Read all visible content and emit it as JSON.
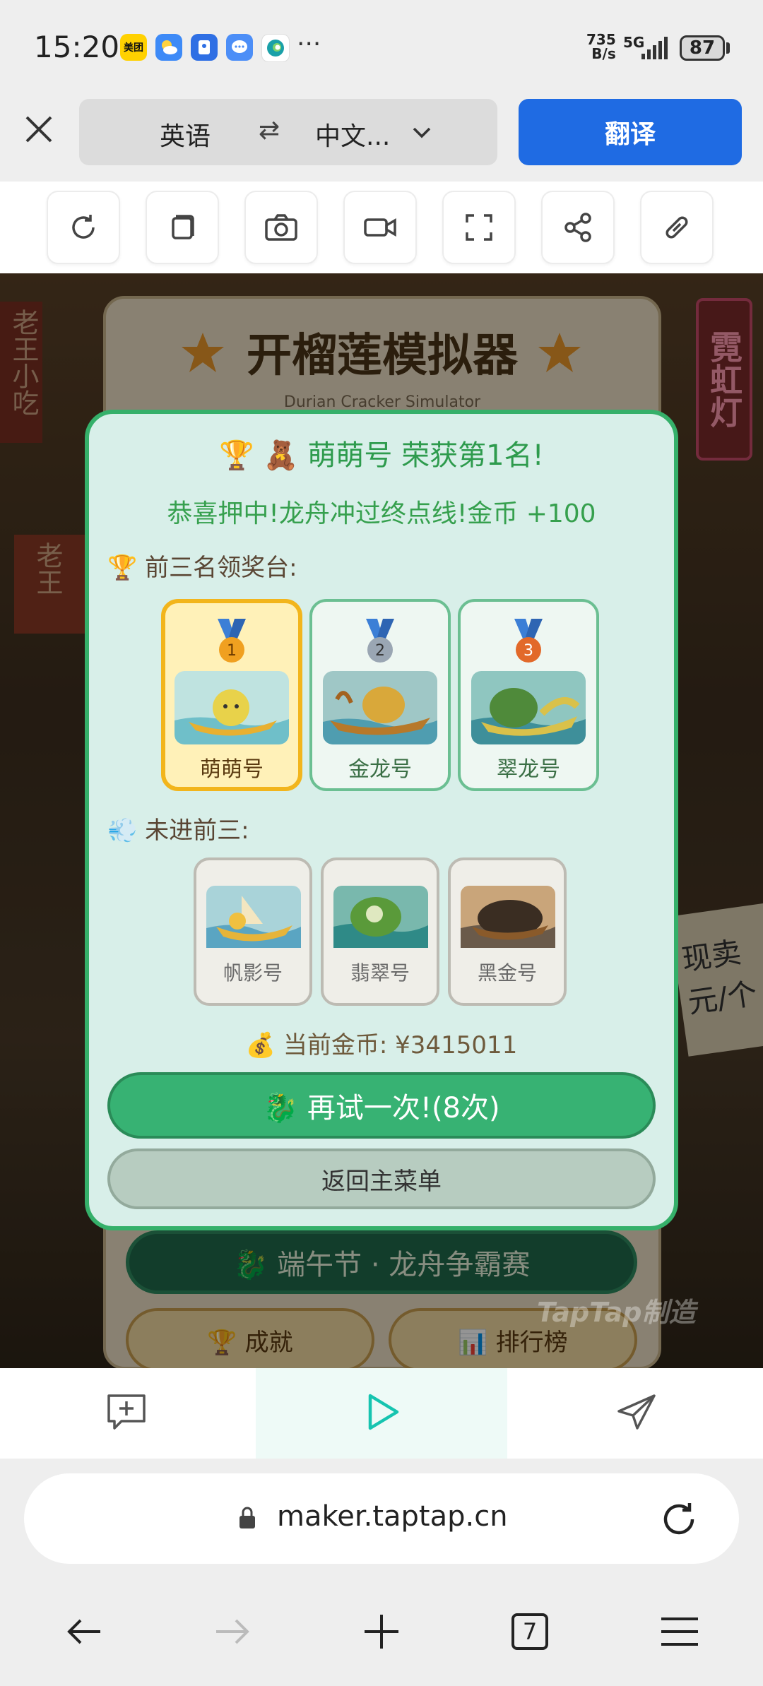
{
  "status_bar": {
    "time": "15:20",
    "app_icons": [
      {
        "name": "meituan-icon",
        "label": "美团",
        "color": "#ffd100"
      },
      {
        "name": "weather-icon",
        "label": "",
        "color": "#3d8af7"
      },
      {
        "name": "app-blue-icon",
        "label": "",
        "color": "#2f6fe4"
      },
      {
        "name": "chat-icon",
        "label": "",
        "color": "#4c8ef7"
      },
      {
        "name": "edge-icon",
        "label": "",
        "color": "#1aa0a8"
      }
    ],
    "more": "···",
    "net_speed_value": "735",
    "net_speed_unit": "B/s",
    "network": "5G",
    "battery": "87"
  },
  "translate_bar": {
    "source_lang": "英语",
    "swap_symbol": "⇄",
    "target_lang": "中文...",
    "translate_button": "翻译"
  },
  "tools": [
    {
      "name": "refresh-tool",
      "icon": "refresh-icon"
    },
    {
      "name": "copy-tool",
      "icon": "copy-icon"
    },
    {
      "name": "camera-tool",
      "icon": "camera-icon"
    },
    {
      "name": "video-tool",
      "icon": "video-icon"
    },
    {
      "name": "fullscreen-tool",
      "icon": "fullscreen-icon"
    },
    {
      "name": "share-tool",
      "icon": "share-icon"
    },
    {
      "name": "link-tool",
      "icon": "link-icon"
    }
  ],
  "game": {
    "title": "开榴莲模拟器",
    "subtitle": "Durian Cracker Simulator",
    "left_sign": "老王小吃",
    "left_sign2": "老王",
    "neon_sign": "霓虹灯",
    "right_board": "现卖\n元/个",
    "event_button": "🐉 端午节 · 龙舟争霸赛",
    "achievements_button": "🏆 成就",
    "leaderboard_button": "📊 排行榜",
    "watermark": "TapTap制造"
  },
  "result_modal": {
    "title": "🏆 🧸 萌萌号 荣获第1名!",
    "message": "恭喜押中!龙舟冲过终点线!金币 +100",
    "podium_label": "🏆 前三名领奖台:",
    "podium": [
      {
        "rank": "1",
        "name": "萌萌号",
        "medal_color": "#f0a020"
      },
      {
        "rank": "2",
        "name": "金龙号",
        "medal_color": "#9aa6b3"
      },
      {
        "rank": "3",
        "name": "翠龙号",
        "medal_color": "#e2692a"
      }
    ],
    "not_top_label": "💨 未进前三:",
    "others": [
      {
        "name": "帆影号"
      },
      {
        "name": "翡翠号"
      },
      {
        "name": "黑金号"
      }
    ],
    "coins": "💰 当前金币: ¥3415011",
    "retry_button": "🐉 再试一次!(8次)",
    "back_button": "返回主菜单"
  },
  "browser": {
    "url": "maker.taptap.cn",
    "tab_count": "7"
  },
  "colors": {
    "accent_blue": "#1f6be3",
    "modal_green": "#35b06a",
    "retry_green": "#37b273",
    "play_teal": "#16c4b0"
  }
}
